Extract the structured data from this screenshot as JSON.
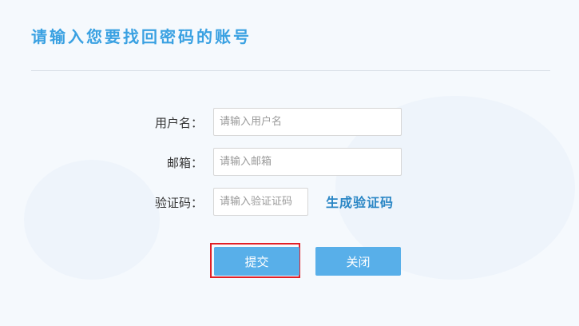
{
  "page": {
    "title": "请输入您要找回密码的账号"
  },
  "form": {
    "username_label": "用户名：",
    "username_placeholder": "请输入用户名",
    "email_label": "邮箱：",
    "email_placeholder": "请输入邮箱",
    "captcha_label": "验证码：",
    "captcha_placeholder": "请输入验证证码",
    "captcha_generate_link": "生成验证码"
  },
  "actions": {
    "submit_label": "提交",
    "close_label": "关闭"
  },
  "colors": {
    "accent": "#3aa1e2",
    "button": "#58afe9",
    "highlight": "#e21f26",
    "link": "#2a86c5"
  }
}
